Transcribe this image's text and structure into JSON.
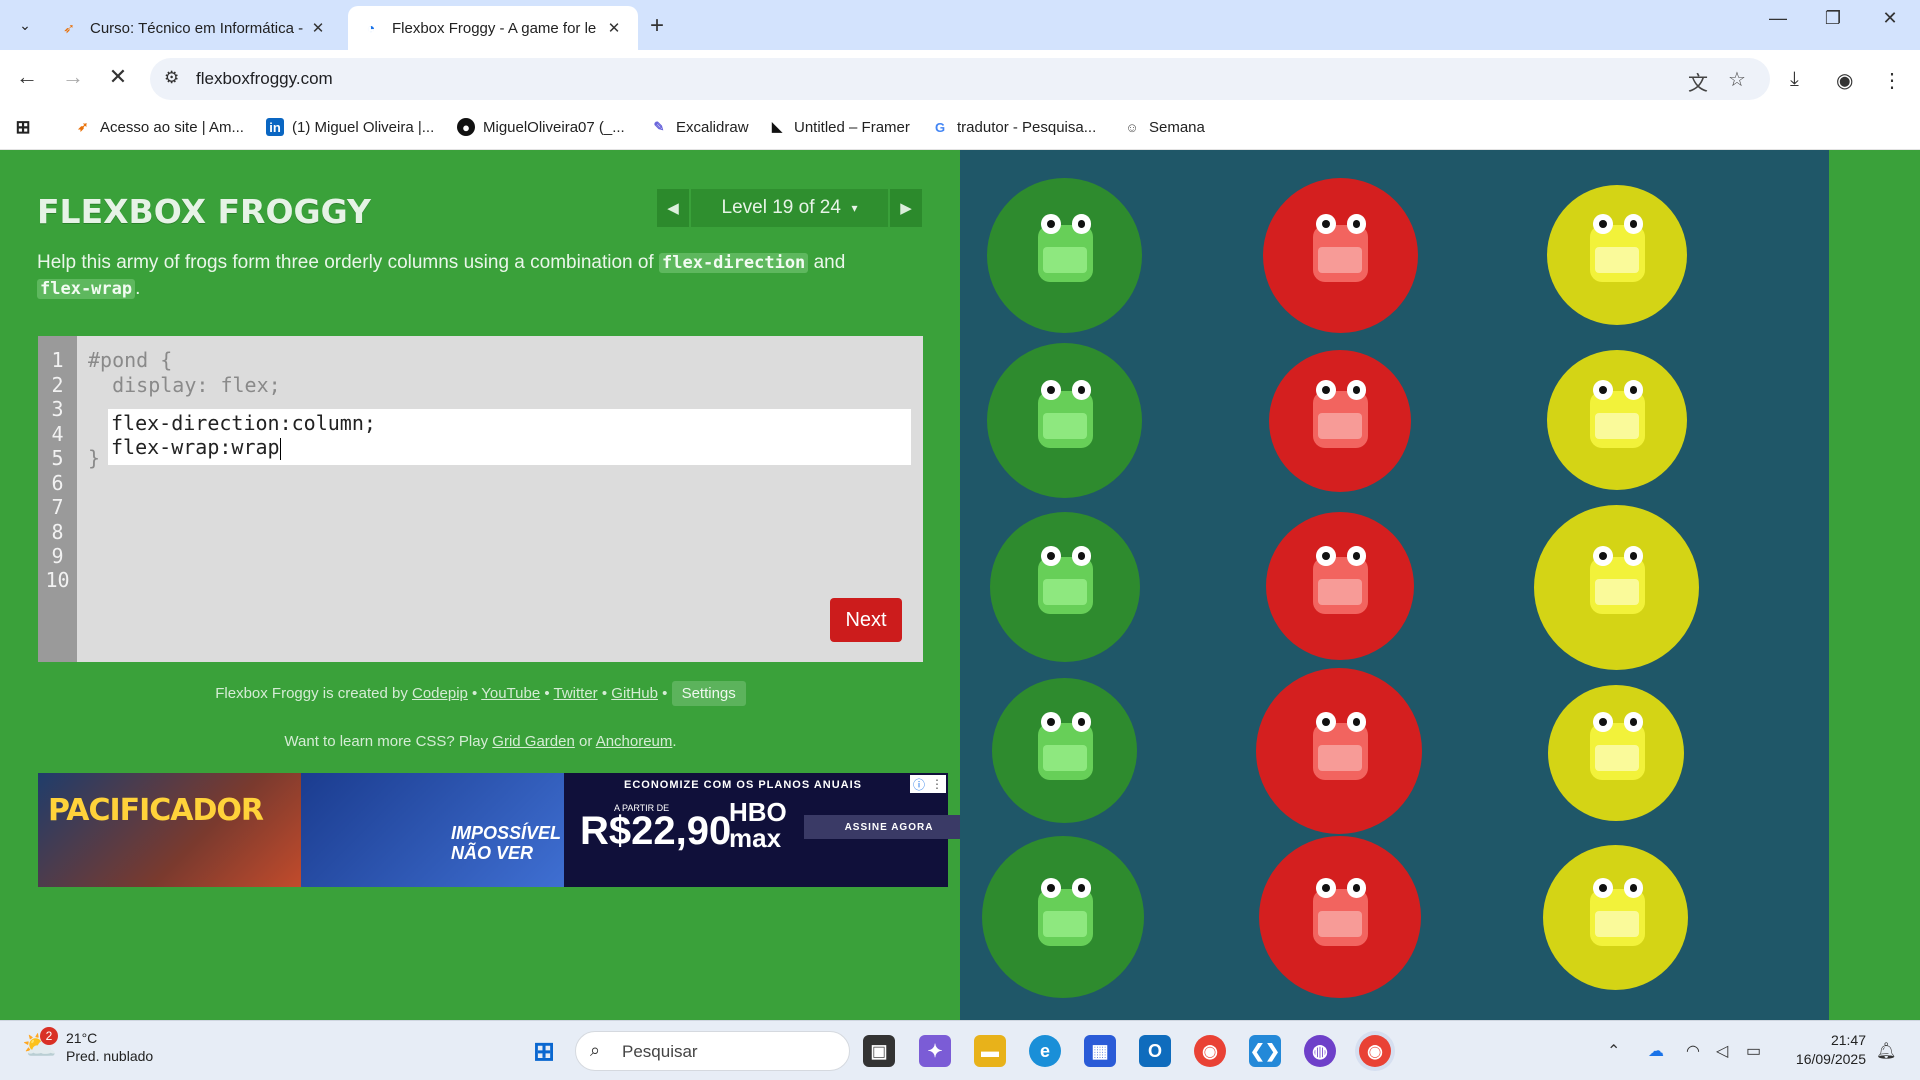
{
  "browser": {
    "tabs": [
      {
        "title": "Curso: Técnico em Informática -",
        "active": false
      },
      {
        "title": "Flexbox Froggy - A game for le",
        "active": true
      }
    ],
    "url": "flexboxfroggy.com",
    "bookmarks": [
      {
        "label": "Acesso ao site | Am...",
        "icon": "amazon-icon"
      },
      {
        "label": "(1) Miguel Oliveira |...",
        "icon": "linkedin-icon"
      },
      {
        "label": "MiguelOliveira07 (_...",
        "icon": "github-icon"
      },
      {
        "label": "Excalidraw",
        "icon": "excalidraw-icon"
      },
      {
        "label": "Untitled – Framer",
        "icon": "framer-icon"
      },
      {
        "label": "tradutor - Pesquisa...",
        "icon": "google-icon"
      },
      {
        "label": "Semana",
        "icon": "person-icon"
      }
    ]
  },
  "game": {
    "logo": "FLEXBOX FROGGY",
    "level_label": "Level 19 of 24",
    "level_dropdown": "▾",
    "instruction_pre": "Help this army of frogs form three orderly columns using a combination of ",
    "keyword1": "flex-direction",
    "instruction_mid": " and ",
    "keyword2": "flex-wrap",
    "instruction_post": ".",
    "line_numbers": [
      "1",
      "2",
      "3",
      "4",
      "5",
      "6",
      "7",
      "8",
      "9",
      "10"
    ],
    "code_line1": "#pond {",
    "code_line2": "  display: flex;",
    "input_line1": "flex-direction:column;",
    "input_line2": "flex-wrap:wrap",
    "code_line5": "}",
    "next_label": "Next",
    "credits_text": "Flexbox Froggy is created by ",
    "credit_codepip": "Codepip",
    "credit_youtube": "YouTube",
    "credit_twitter": "Twitter",
    "credit_github": "GitHub",
    "settings_label": "Settings",
    "learn_text": "Want to learn more CSS? Play ",
    "learn_grid": "Grid Garden",
    "learn_or": " or ",
    "learn_anchor": "Anchoreum",
    "learn_end": "."
  },
  "ad": {
    "banner1": "PACIFICADOR",
    "banner2_line1": "IMPOSSÍVEL",
    "banner2_line2": "NÃO VER",
    "top_text": "ECONOMIZE COM OS PLANOS ANUAIS",
    "from_text": "A PARTIR DE",
    "price": "R$22,90",
    "brand_line1": "HBO",
    "brand_line2": "max",
    "cta": "ASSINE AGORA"
  },
  "colors": {
    "green_frog": "#4caf3f",
    "red_frog": "#e32a2a",
    "yellow_frog": "#d9d91a",
    "pond": "#1f5768",
    "page_bg": "#3aa13a"
  },
  "taskbar": {
    "weather_badge": "2",
    "temperature": "21°C",
    "condition": "Pred. nublado",
    "search_placeholder": "Pesquisar",
    "time": "21:47",
    "date": "16/09/2025"
  }
}
